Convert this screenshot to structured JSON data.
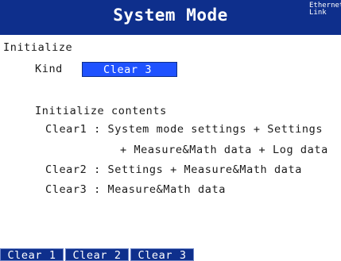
{
  "header": {
    "title": "System Mode",
    "status_line1": "Ethernet",
    "status_line2": "Link"
  },
  "section": {
    "title": "Initialize"
  },
  "kind": {
    "label": "Kind",
    "value": "Clear 3"
  },
  "contents": {
    "heading": "Initialize contents",
    "clear1_line1": "Clear1 : System mode settings + Settings",
    "clear1_line2": "+ Measure&Math data + Log data",
    "clear2": "Clear2 : Settings + Measure&Math data",
    "clear3": "Clear3 : Measure&Math data"
  },
  "softkeys": [
    "Clear 1",
    "Clear 2",
    "Clear 3"
  ],
  "colors": {
    "title_bar": "#0e2f8c",
    "selected_field": "#1f52ff",
    "softkey_bg": "#0e2f8c"
  }
}
